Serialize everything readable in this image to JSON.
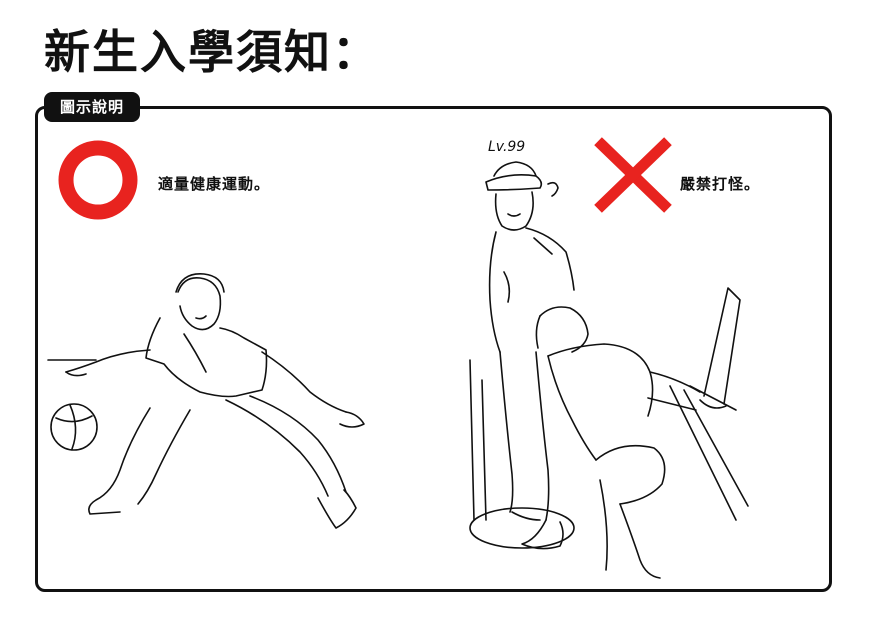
{
  "page": {
    "title": "新生入學須知："
  },
  "legend": {
    "tab_label": "圖示說明"
  },
  "allowed": {
    "symbol": "circle",
    "color": "#e8231f",
    "caption": "適量健康運動。"
  },
  "forbidden": {
    "symbol": "cross",
    "color": "#e8231f",
    "caption": "嚴禁打怪。"
  },
  "illustrations": {
    "right_badge_text": "Lv.99"
  }
}
